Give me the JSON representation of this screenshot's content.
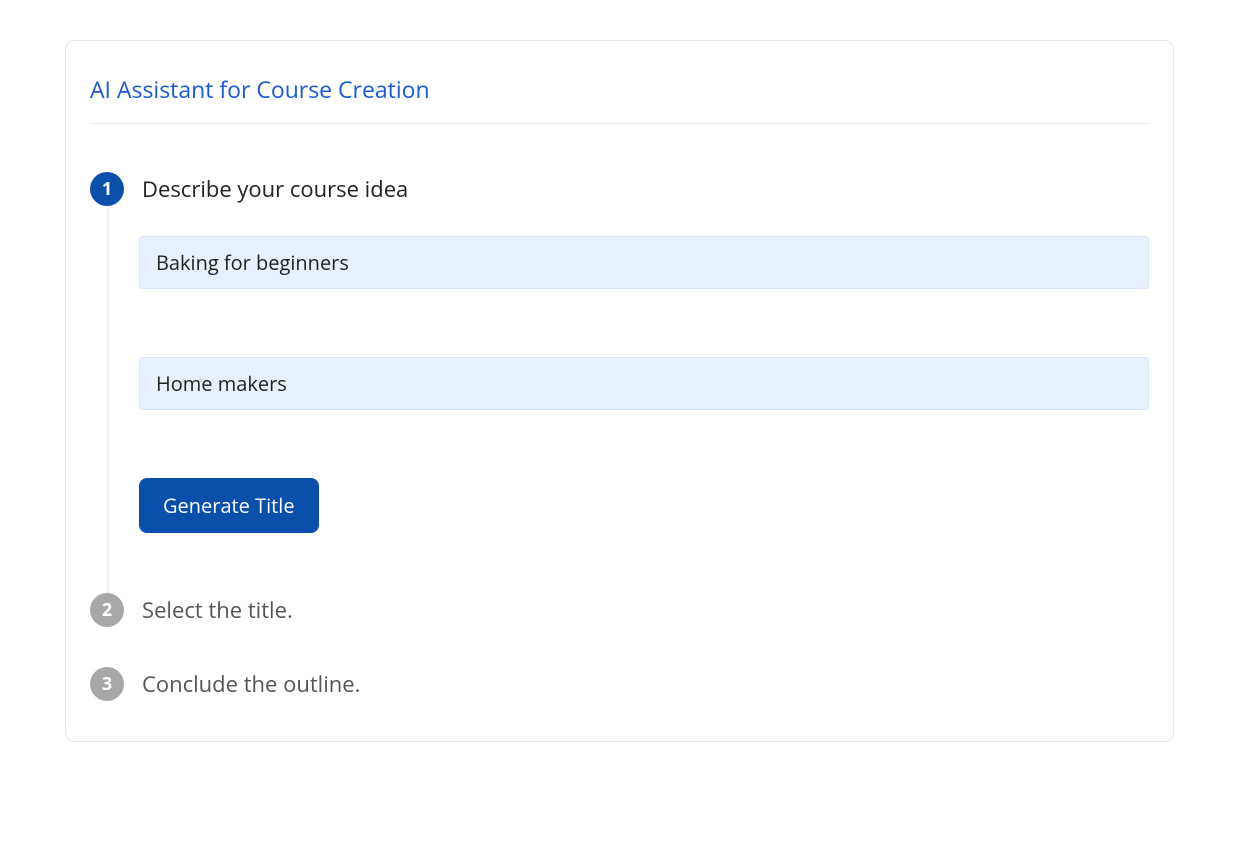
{
  "header": {
    "title": "AI Assistant for Course Creation"
  },
  "steps": [
    {
      "number": "1",
      "label": "Describe your course idea",
      "active": true,
      "fields": {
        "course_idea": {
          "value": "Baking for beginners"
        },
        "audience": {
          "value": "Home makers"
        }
      },
      "button": {
        "label": "Generate Title"
      }
    },
    {
      "number": "2",
      "label": "Select the title.",
      "active": false
    },
    {
      "number": "3",
      "label": "Conclude the outline.",
      "active": false
    }
  ]
}
